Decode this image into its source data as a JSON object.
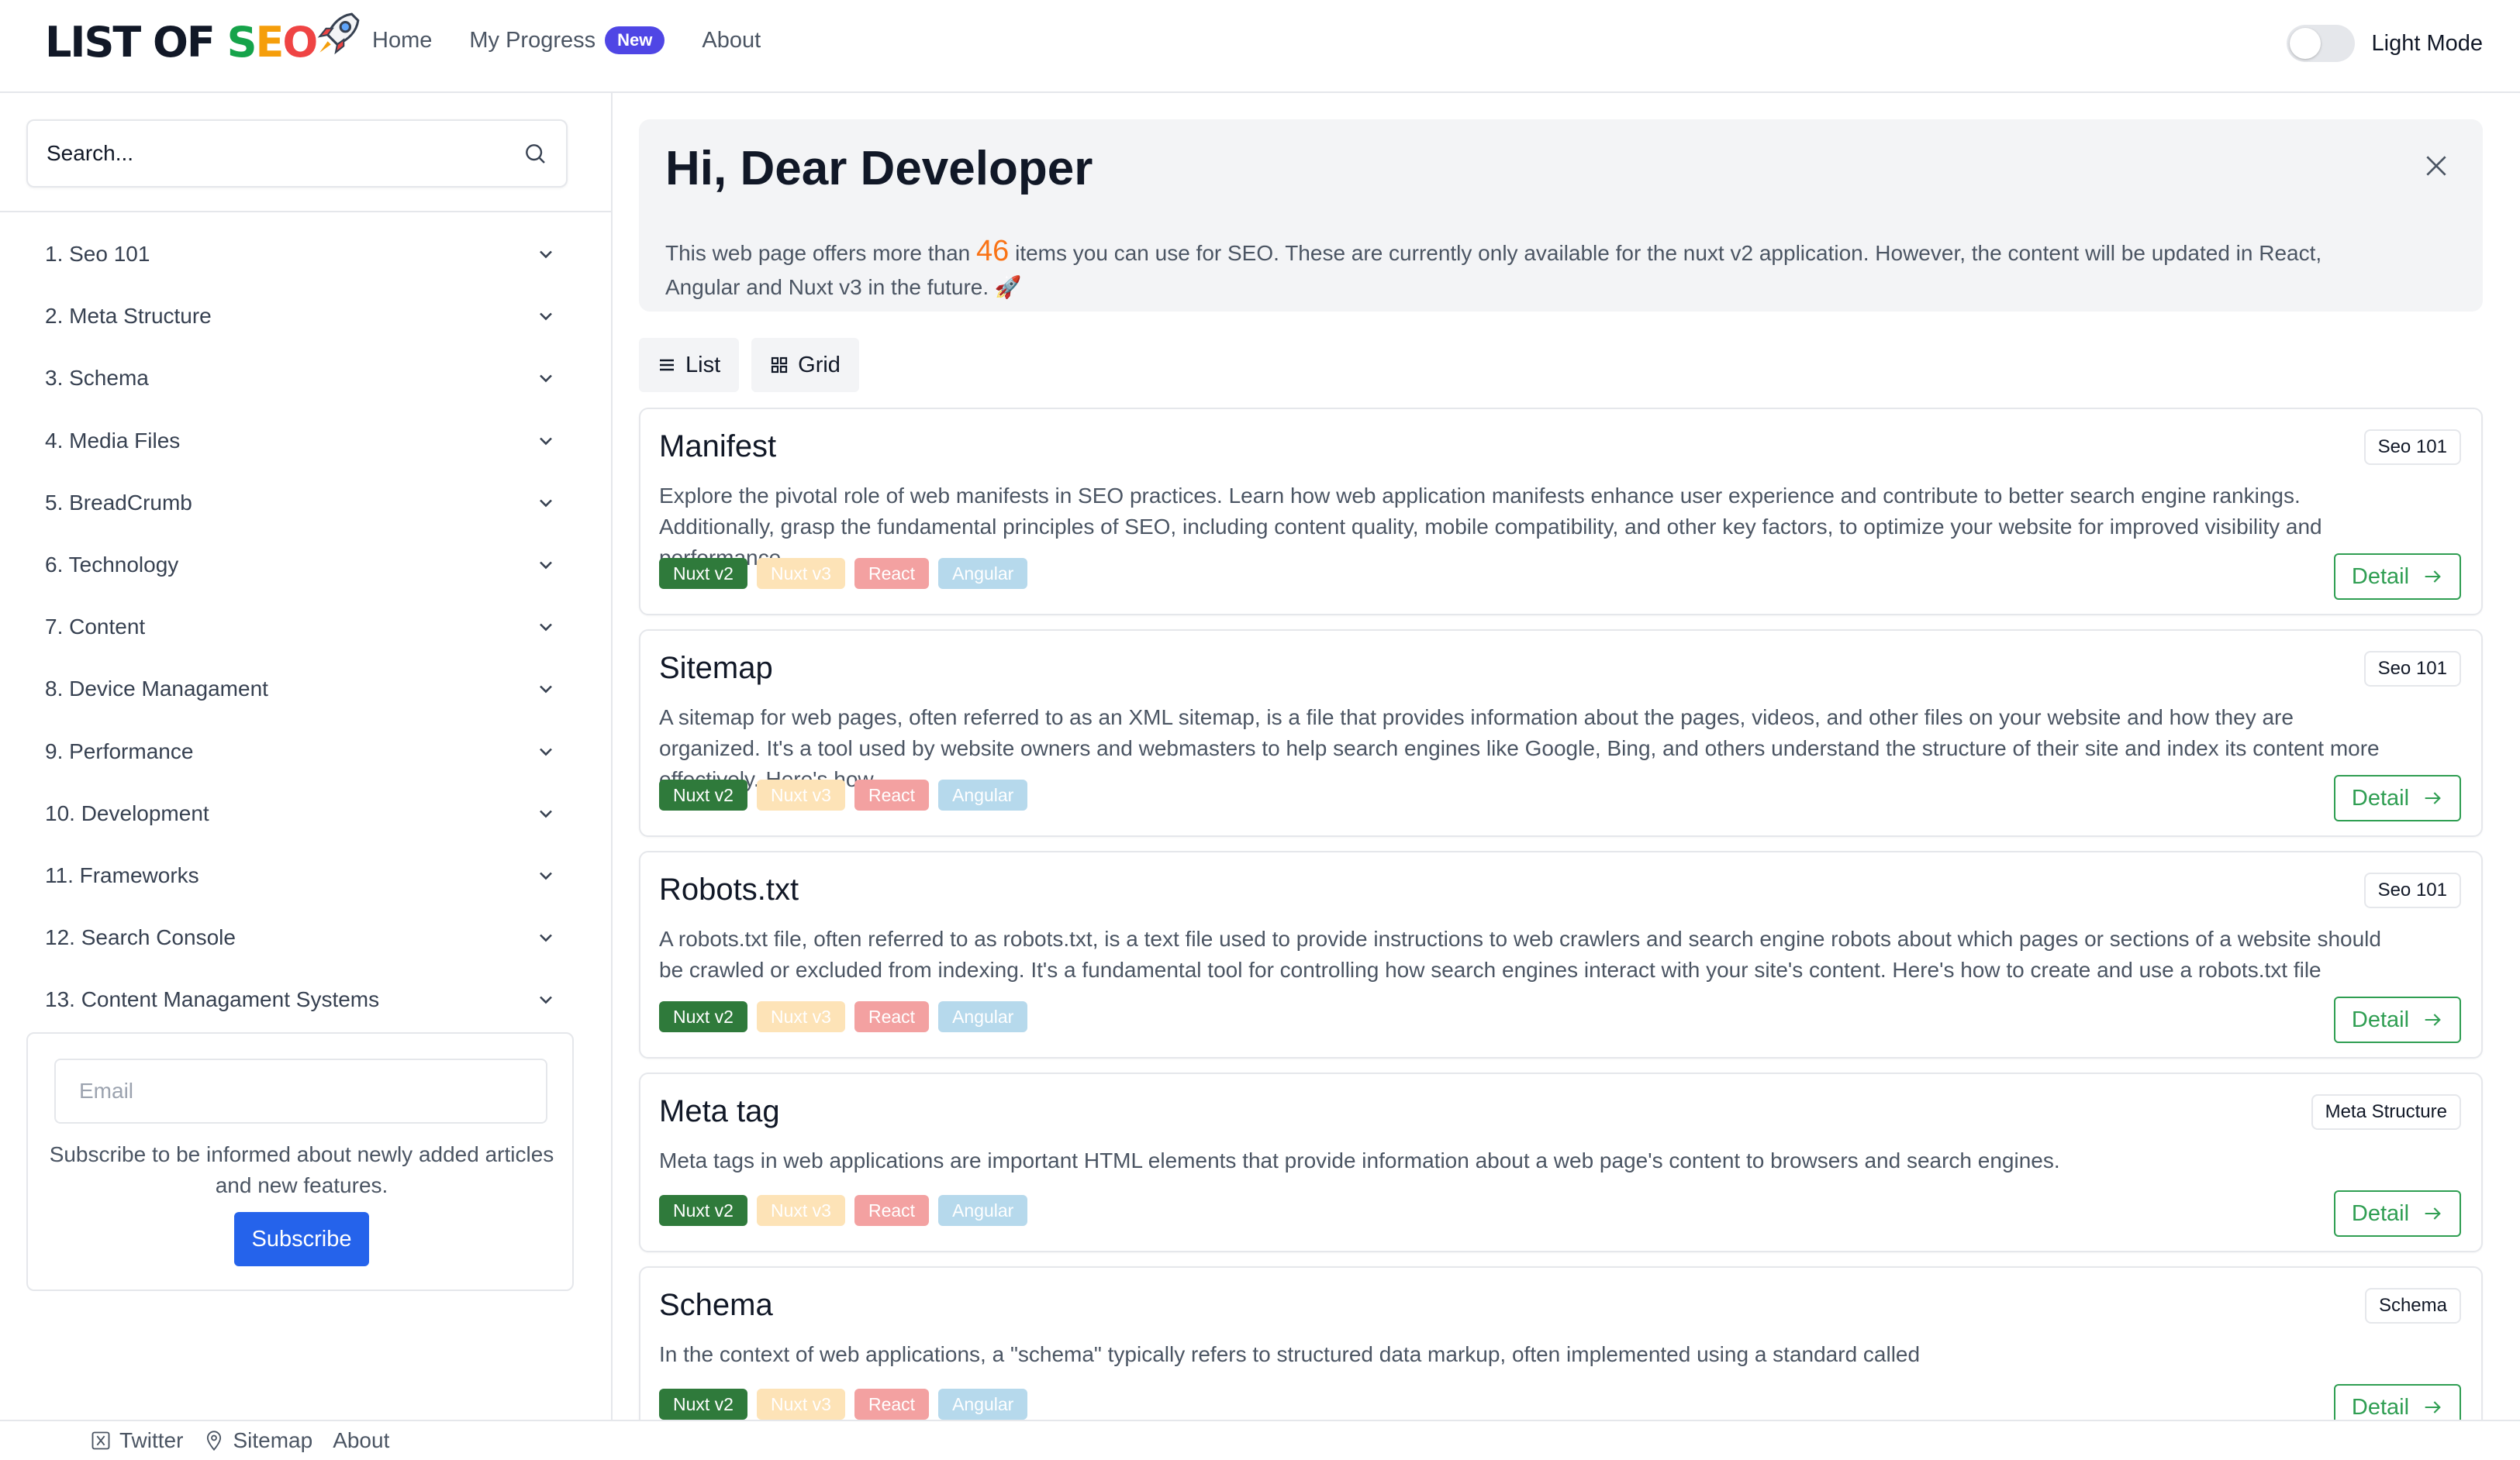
{
  "header": {
    "logo": {
      "list_of": "LIST OF ",
      "s": "S",
      "e": "E",
      "o": "O"
    },
    "nav": {
      "home": "Home",
      "progress": "My Progress",
      "progress_badge": "New",
      "about": "About"
    },
    "theme_label": "Light Mode"
  },
  "sidebar": {
    "search_placeholder": "Search...",
    "categories": [
      "1. Seo 101",
      "2. Meta Structure",
      "3. Schema",
      "4. Media Files",
      "5. BreadCrumb",
      "6. Technology",
      "7. Content",
      "8. Device Managament",
      "9. Performance",
      "10. Development",
      "11. Frameworks",
      "12. Search Console",
      "13. Content Managament Systems"
    ],
    "subscribe": {
      "email_placeholder": "Email",
      "text": "Subscribe to be informed about newly added articles and new features.",
      "button": "Subscribe"
    }
  },
  "hero": {
    "title": "Hi, Dear Developer",
    "text_before": "This web page offers more than ",
    "count": "46",
    "text_after": " items you can use for SEO. These are currently only available for the nuxt v2 application. However, the content will be updated in React, Angular and Nuxt v3 in the future. 🚀"
  },
  "view": {
    "list": "List",
    "grid": "Grid"
  },
  "cards": [
    {
      "title": "Manifest",
      "category": "Seo 101",
      "description": "Explore the pivotal role of web manifests in SEO practices. Learn how web application manifests enhance user experience and contribute to better search engine rankings. Additionally, grasp the fundamental principles of SEO, including content quality, mobile compatibility, and other key factors, to optimize your website for improved visibility and performance."
    },
    {
      "title": "Sitemap",
      "category": "Seo 101",
      "description": "A sitemap for web pages, often referred to as an XML sitemap, is a file that provides information about the pages, videos, and other files on your website and how they are organized. It's a tool used by website owners and webmasters to help search engines like Google, Bing, and others understand the structure of their site and index its content more effectively. Here's how"
    },
    {
      "title": "Robots.txt",
      "category": "Seo 101",
      "description": "A robots.txt file, often referred to as robots.txt, is a text file used to provide instructions to web crawlers and search engine robots about which pages or sections of a website should be crawled or excluded from indexing. It's a fundamental tool for controlling how search engines interact with your site's content. Here's how to create and use a robots.txt file"
    },
    {
      "title": "Meta tag",
      "category": "Meta Structure",
      "description": "Meta tags in web applications are important HTML elements that provide information about a web page's content to browsers and search engines."
    },
    {
      "title": "Schema",
      "category": "Schema",
      "description": "In the context of web applications, a \"schema\" typically refers to structured data markup, often implemented using a standard called"
    }
  ],
  "tags": {
    "nuxt2": "Nuxt v2",
    "nuxt3": "Nuxt v3",
    "react": "React",
    "angular": "Angular"
  },
  "detail_label": "Detail",
  "footer": {
    "twitter": "Twitter",
    "sitemap": "Sitemap",
    "about": "About"
  }
}
